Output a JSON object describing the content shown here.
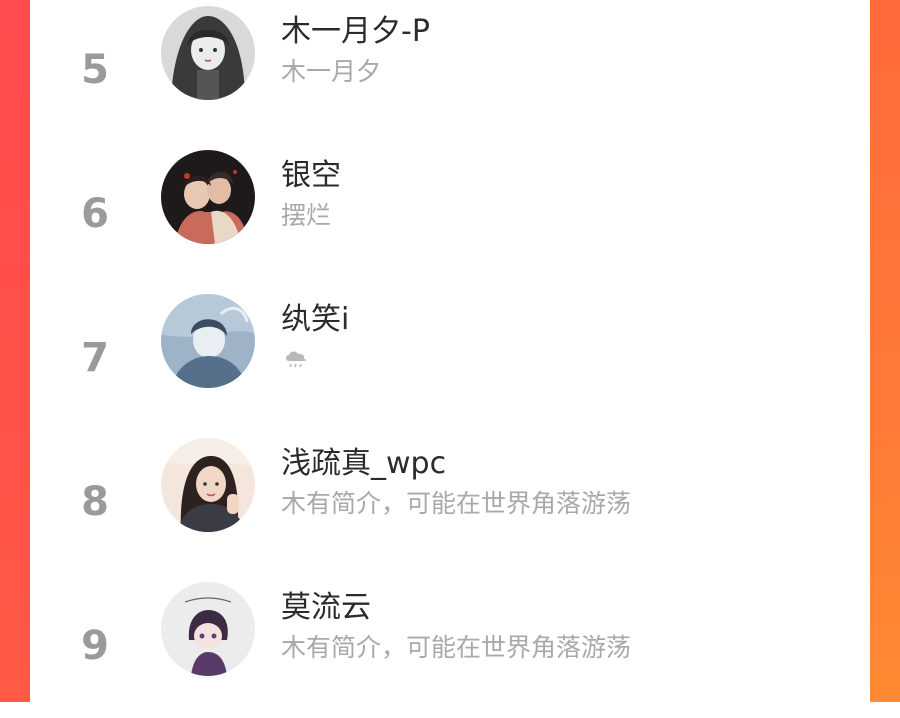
{
  "colors": {
    "panel_bg": "#ffffff",
    "accent_left": "#ff4a4f",
    "accent_right": "#ff7a36",
    "rank_color": "#9a9a9a",
    "name_color": "#2b2b2b",
    "bio_color": "#a9a9a9"
  },
  "list": [
    {
      "rank": "5",
      "name": "木一月夕-P",
      "bio": "木一月夕",
      "avatar": "avatar-dark-hair-girl"
    },
    {
      "rank": "6",
      "name": "银空",
      "bio": "摆烂",
      "avatar": "avatar-couple-illustration"
    },
    {
      "rank": "7",
      "name": "纨笑i",
      "bio": "",
      "bio_icon": "cloud-rain-icon",
      "avatar": "avatar-blue-illustration"
    },
    {
      "rank": "8",
      "name": "浅疏真_wpc",
      "bio": "木有简介，可能在世界角落游荡",
      "avatar": "avatar-photo-girl-waving"
    },
    {
      "rank": "9",
      "name": "莫流云",
      "bio": "木有简介，可能在世界角落游荡",
      "avatar": "avatar-chibi-character"
    }
  ]
}
